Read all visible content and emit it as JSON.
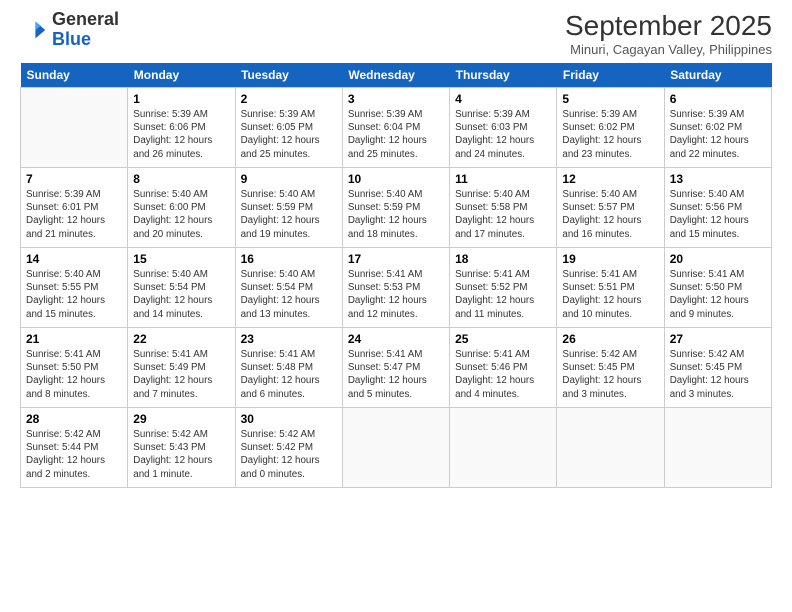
{
  "logo": {
    "general": "General",
    "blue": "Blue"
  },
  "header": {
    "month": "September 2025",
    "subtitle": "Minuri, Cagayan Valley, Philippines"
  },
  "days_of_week": [
    "Sunday",
    "Monday",
    "Tuesday",
    "Wednesday",
    "Thursday",
    "Friday",
    "Saturday"
  ],
  "weeks": [
    [
      {
        "day": "",
        "info": ""
      },
      {
        "day": "1",
        "info": "Sunrise: 5:39 AM\nSunset: 6:06 PM\nDaylight: 12 hours\nand 26 minutes."
      },
      {
        "day": "2",
        "info": "Sunrise: 5:39 AM\nSunset: 6:05 PM\nDaylight: 12 hours\nand 25 minutes."
      },
      {
        "day": "3",
        "info": "Sunrise: 5:39 AM\nSunset: 6:04 PM\nDaylight: 12 hours\nand 25 minutes."
      },
      {
        "day": "4",
        "info": "Sunrise: 5:39 AM\nSunset: 6:03 PM\nDaylight: 12 hours\nand 24 minutes."
      },
      {
        "day": "5",
        "info": "Sunrise: 5:39 AM\nSunset: 6:02 PM\nDaylight: 12 hours\nand 23 minutes."
      },
      {
        "day": "6",
        "info": "Sunrise: 5:39 AM\nSunset: 6:02 PM\nDaylight: 12 hours\nand 22 minutes."
      }
    ],
    [
      {
        "day": "7",
        "info": "Sunrise: 5:39 AM\nSunset: 6:01 PM\nDaylight: 12 hours\nand 21 minutes."
      },
      {
        "day": "8",
        "info": "Sunrise: 5:40 AM\nSunset: 6:00 PM\nDaylight: 12 hours\nand 20 minutes."
      },
      {
        "day": "9",
        "info": "Sunrise: 5:40 AM\nSunset: 5:59 PM\nDaylight: 12 hours\nand 19 minutes."
      },
      {
        "day": "10",
        "info": "Sunrise: 5:40 AM\nSunset: 5:59 PM\nDaylight: 12 hours\nand 18 minutes."
      },
      {
        "day": "11",
        "info": "Sunrise: 5:40 AM\nSunset: 5:58 PM\nDaylight: 12 hours\nand 17 minutes."
      },
      {
        "day": "12",
        "info": "Sunrise: 5:40 AM\nSunset: 5:57 PM\nDaylight: 12 hours\nand 16 minutes."
      },
      {
        "day": "13",
        "info": "Sunrise: 5:40 AM\nSunset: 5:56 PM\nDaylight: 12 hours\nand 15 minutes."
      }
    ],
    [
      {
        "day": "14",
        "info": "Sunrise: 5:40 AM\nSunset: 5:55 PM\nDaylight: 12 hours\nand 15 minutes."
      },
      {
        "day": "15",
        "info": "Sunrise: 5:40 AM\nSunset: 5:54 PM\nDaylight: 12 hours\nand 14 minutes."
      },
      {
        "day": "16",
        "info": "Sunrise: 5:40 AM\nSunset: 5:54 PM\nDaylight: 12 hours\nand 13 minutes."
      },
      {
        "day": "17",
        "info": "Sunrise: 5:41 AM\nSunset: 5:53 PM\nDaylight: 12 hours\nand 12 minutes."
      },
      {
        "day": "18",
        "info": "Sunrise: 5:41 AM\nSunset: 5:52 PM\nDaylight: 12 hours\nand 11 minutes."
      },
      {
        "day": "19",
        "info": "Sunrise: 5:41 AM\nSunset: 5:51 PM\nDaylight: 12 hours\nand 10 minutes."
      },
      {
        "day": "20",
        "info": "Sunrise: 5:41 AM\nSunset: 5:50 PM\nDaylight: 12 hours\nand 9 minutes."
      }
    ],
    [
      {
        "day": "21",
        "info": "Sunrise: 5:41 AM\nSunset: 5:50 PM\nDaylight: 12 hours\nand 8 minutes."
      },
      {
        "day": "22",
        "info": "Sunrise: 5:41 AM\nSunset: 5:49 PM\nDaylight: 12 hours\nand 7 minutes."
      },
      {
        "day": "23",
        "info": "Sunrise: 5:41 AM\nSunset: 5:48 PM\nDaylight: 12 hours\nand 6 minutes."
      },
      {
        "day": "24",
        "info": "Sunrise: 5:41 AM\nSunset: 5:47 PM\nDaylight: 12 hours\nand 5 minutes."
      },
      {
        "day": "25",
        "info": "Sunrise: 5:41 AM\nSunset: 5:46 PM\nDaylight: 12 hours\nand 4 minutes."
      },
      {
        "day": "26",
        "info": "Sunrise: 5:42 AM\nSunset: 5:45 PM\nDaylight: 12 hours\nand 3 minutes."
      },
      {
        "day": "27",
        "info": "Sunrise: 5:42 AM\nSunset: 5:45 PM\nDaylight: 12 hours\nand 3 minutes."
      }
    ],
    [
      {
        "day": "28",
        "info": "Sunrise: 5:42 AM\nSunset: 5:44 PM\nDaylight: 12 hours\nand 2 minutes."
      },
      {
        "day": "29",
        "info": "Sunrise: 5:42 AM\nSunset: 5:43 PM\nDaylight: 12 hours\nand 1 minute."
      },
      {
        "day": "30",
        "info": "Sunrise: 5:42 AM\nSunset: 5:42 PM\nDaylight: 12 hours\nand 0 minutes."
      },
      {
        "day": "",
        "info": ""
      },
      {
        "day": "",
        "info": ""
      },
      {
        "day": "",
        "info": ""
      },
      {
        "day": "",
        "info": ""
      }
    ]
  ]
}
